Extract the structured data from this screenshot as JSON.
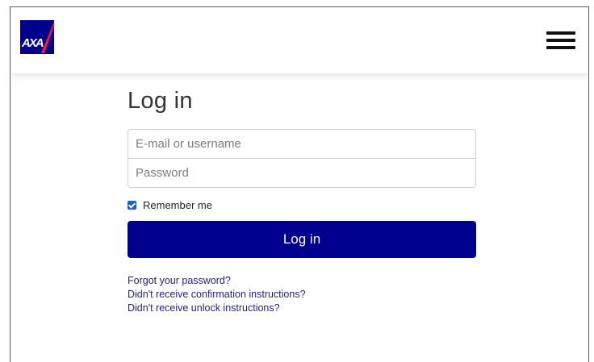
{
  "brand": {
    "logo_text": "AXA",
    "primary_color": "#00008f",
    "accent_color": "#ff1721"
  },
  "header": {
    "menu_icon": "hamburger-menu-icon"
  },
  "login": {
    "title": "Log in",
    "username_placeholder": "E-mail or username",
    "password_placeholder": "Password",
    "remember_label": "Remember me",
    "remember_checked": true,
    "submit_label": "Log in"
  },
  "links": {
    "forgot_password": "Forgot your password?",
    "confirmation_instructions": "Didn't receive confirmation instructions?",
    "unlock_instructions": "Didn't receive unlock instructions?"
  }
}
